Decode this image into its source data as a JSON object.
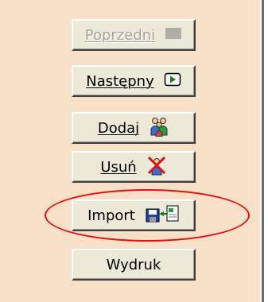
{
  "buttons": {
    "prev": {
      "label": "Poprzedni",
      "icon": "disabled-square-icon",
      "disabled": true
    },
    "next": {
      "label": "Następny",
      "icon": "next-arrow-icon"
    },
    "add": {
      "label": "Dodaj",
      "icon": "users-add-icon"
    },
    "remove": {
      "label": "Usuń",
      "icon": "user-delete-icon"
    },
    "import": {
      "label": "Import",
      "icon": "import-floppy-icon"
    },
    "print": {
      "label": "Wydruk"
    }
  },
  "colors": {
    "panel_background": "#f8e0c8",
    "button_face": "#ece9d8",
    "highlight_oval": "#e01010"
  }
}
